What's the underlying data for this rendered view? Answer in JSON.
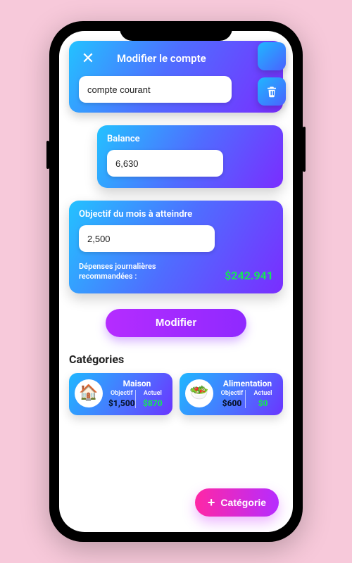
{
  "header": {
    "title": "Modifier le compte",
    "account_name": "compte courant"
  },
  "balance": {
    "label": "Balance",
    "value": "6,630"
  },
  "objective": {
    "label": "Objectif du mois à atteindre",
    "value": "2,500",
    "reco_label": "Dépenses journalières recommandées :",
    "reco_amount": "$242.941"
  },
  "modify_label": "Modifier",
  "categories_title": "Catégories",
  "categories": [
    {
      "icon": "🏠",
      "title": "Maison",
      "obj_label": "Objectif",
      "act_label": "Actuel",
      "obj_value": "$1,500",
      "act_value": "$870"
    },
    {
      "icon": "🥗",
      "title": "Alimentation",
      "obj_label": "Objectif",
      "act_label": "Actuel",
      "obj_value": "$600",
      "act_value": "$0"
    }
  ],
  "add_category_label": "Catégorie"
}
